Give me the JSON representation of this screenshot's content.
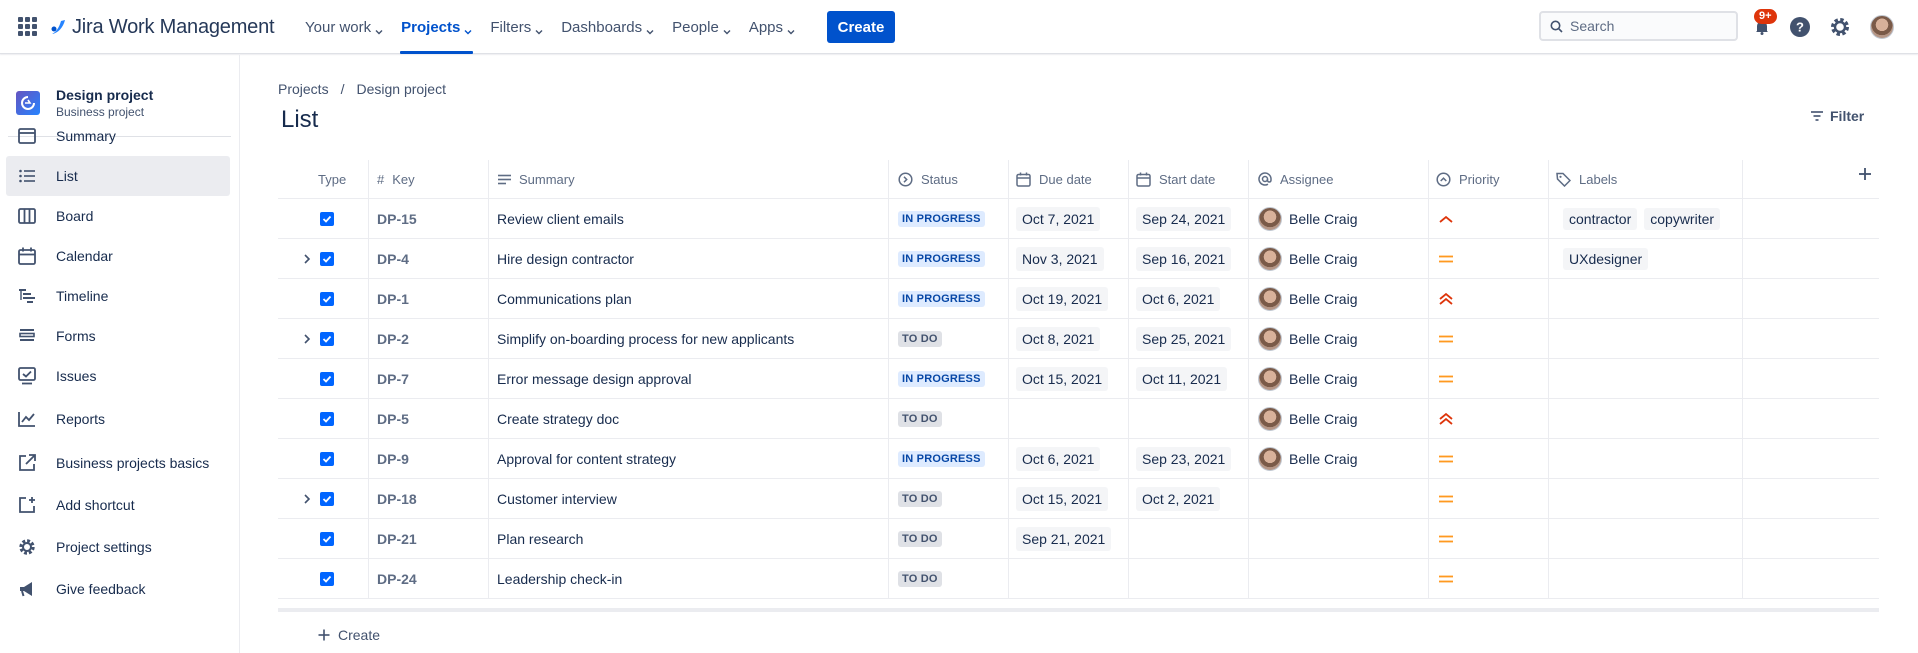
{
  "topbar": {
    "brand": "Jira Work Management",
    "nav": [
      {
        "label": "Your work",
        "active": false
      },
      {
        "label": "Projects",
        "active": true
      },
      {
        "label": "Filters",
        "active": false
      },
      {
        "label": "Dashboards",
        "active": false
      },
      {
        "label": "People",
        "active": false
      },
      {
        "label": "Apps",
        "active": false
      }
    ],
    "create_label": "Create",
    "search_placeholder": "Search",
    "notifications_badge": "9+",
    "brand_color": "#0052cc"
  },
  "sidebar": {
    "project_name": "Design project",
    "project_type": "Business project",
    "items": [
      {
        "label": "Summary",
        "icon": "summary-icon",
        "active": false
      },
      {
        "label": "List",
        "icon": "list-icon",
        "active": true
      },
      {
        "label": "Board",
        "icon": "board-icon",
        "active": false
      },
      {
        "label": "Calendar",
        "icon": "calendar-icon",
        "active": false
      },
      {
        "label": "Timeline",
        "icon": "timeline-icon",
        "active": false
      },
      {
        "label": "Forms",
        "icon": "forms-icon",
        "active": false
      },
      {
        "label": "Issues",
        "icon": "issues-icon",
        "active": false
      },
      {
        "label": "Reports",
        "icon": "reports-icon",
        "active": false
      },
      {
        "label": "Business projects basics",
        "icon": "external-link-icon",
        "active": false
      },
      {
        "label": "Add shortcut",
        "icon": "add-shortcut-icon",
        "active": false
      },
      {
        "label": "Project settings",
        "icon": "gear-icon",
        "active": false
      },
      {
        "label": "Give feedback",
        "icon": "megaphone-icon",
        "active": false
      }
    ]
  },
  "breadcrumb": [
    "Projects",
    "Design project"
  ],
  "page": {
    "title": "List",
    "filter_label": "Filter"
  },
  "columns": {
    "type": "Type",
    "key": "Key",
    "summary": "Summary",
    "status": "Status",
    "due_date": "Due date",
    "start_date": "Start date",
    "assignee": "Assignee",
    "priority": "Priority",
    "labels": "Labels"
  },
  "rows": [
    {
      "key": "DP-15",
      "summary": "Review client emails",
      "status": "IN PROGRESS",
      "due": "Oct 7, 2021",
      "start": "Sep 24, 2021",
      "assignee": "Belle Craig",
      "priority": "high",
      "labels": [
        "contractor",
        "copywriter"
      ],
      "expandable": false
    },
    {
      "key": "DP-4",
      "summary": "Hire design contractor",
      "status": "IN PROGRESS",
      "due": "Nov 3, 2021",
      "start": "Sep 16, 2021",
      "assignee": "Belle Craig",
      "priority": "medium",
      "labels": [
        "UXdesigner"
      ],
      "expandable": true
    },
    {
      "key": "DP-1",
      "summary": "Communications plan",
      "status": "IN PROGRESS",
      "due": "Oct 19, 2021",
      "start": "Oct 6, 2021",
      "assignee": "Belle Craig",
      "priority": "highest",
      "labels": [],
      "expandable": false
    },
    {
      "key": "DP-2",
      "summary": "Simplify on-boarding process for new applicants",
      "status": "TO DO",
      "due": "Oct 8, 2021",
      "start": "Sep 25, 2021",
      "assignee": "Belle Craig",
      "priority": "medium",
      "labels": [],
      "expandable": true
    },
    {
      "key": "DP-7",
      "summary": "Error message design approval",
      "status": "IN PROGRESS",
      "due": "Oct 15, 2021",
      "start": "Oct 11, 2021",
      "assignee": "Belle Craig",
      "priority": "medium",
      "labels": [],
      "expandable": false
    },
    {
      "key": "DP-5",
      "summary": "Create strategy doc",
      "status": "TO DO",
      "due": "",
      "start": "",
      "assignee": "Belle Craig",
      "priority": "highest",
      "labels": [],
      "expandable": false
    },
    {
      "key": "DP-9",
      "summary": "Approval for content strategy",
      "status": "IN PROGRESS",
      "due": "Oct 6, 2021",
      "start": "Sep 23, 2021",
      "assignee": "Belle Craig",
      "priority": "medium",
      "labels": [],
      "expandable": false
    },
    {
      "key": "DP-18",
      "summary": "Customer interview",
      "status": "TO DO",
      "due": "Oct 15, 2021",
      "start": "Oct 2, 2021",
      "assignee": "",
      "priority": "medium",
      "labels": [],
      "expandable": true
    },
    {
      "key": "DP-21",
      "summary": "Plan research",
      "status": "TO DO",
      "due": "Sep 21, 2021",
      "start": "",
      "assignee": "",
      "priority": "medium",
      "labels": [],
      "expandable": false
    },
    {
      "key": "DP-24",
      "summary": "Leadership check-in",
      "status": "TO DO",
      "due": "",
      "start": "",
      "assignee": "",
      "priority": "medium",
      "labels": [],
      "expandable": false
    }
  ],
  "footer": {
    "create_label": "Create"
  }
}
